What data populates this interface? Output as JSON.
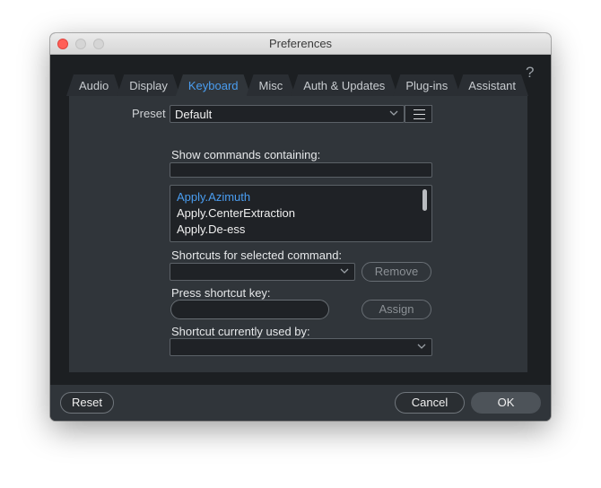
{
  "window": {
    "title": "Preferences"
  },
  "help_label": "?",
  "tabs": [
    {
      "label": "Audio",
      "active": false
    },
    {
      "label": "Display",
      "active": false
    },
    {
      "label": "Keyboard",
      "active": true
    },
    {
      "label": "Misc",
      "active": false
    },
    {
      "label": "Auth & Updates",
      "active": false
    },
    {
      "label": "Plug-ins",
      "active": false
    },
    {
      "label": "Assistant",
      "active": false
    }
  ],
  "preset": {
    "label": "Preset",
    "value": "Default"
  },
  "commands": {
    "filter_label": "Show commands containing:",
    "filter_value": "",
    "items": [
      {
        "label": "Apply.Azimuth",
        "selected": true
      },
      {
        "label": "Apply.CenterExtraction",
        "selected": false
      },
      {
        "label": "Apply.De-ess",
        "selected": false
      }
    ]
  },
  "shortcuts": {
    "label": "Shortcuts for selected command:",
    "value": "",
    "remove_label": "Remove"
  },
  "press": {
    "label": "Press shortcut key:",
    "value": "",
    "assign_label": "Assign"
  },
  "used_by": {
    "label": "Shortcut currently used by:",
    "value": ""
  },
  "footer": {
    "reset_label": "Reset",
    "cancel_label": "Cancel",
    "ok_label": "OK"
  },
  "colors": {
    "accent": "#4a9df0",
    "panel": "#30353a",
    "background": "#1c1f22",
    "close_button": "#ff5f57"
  }
}
